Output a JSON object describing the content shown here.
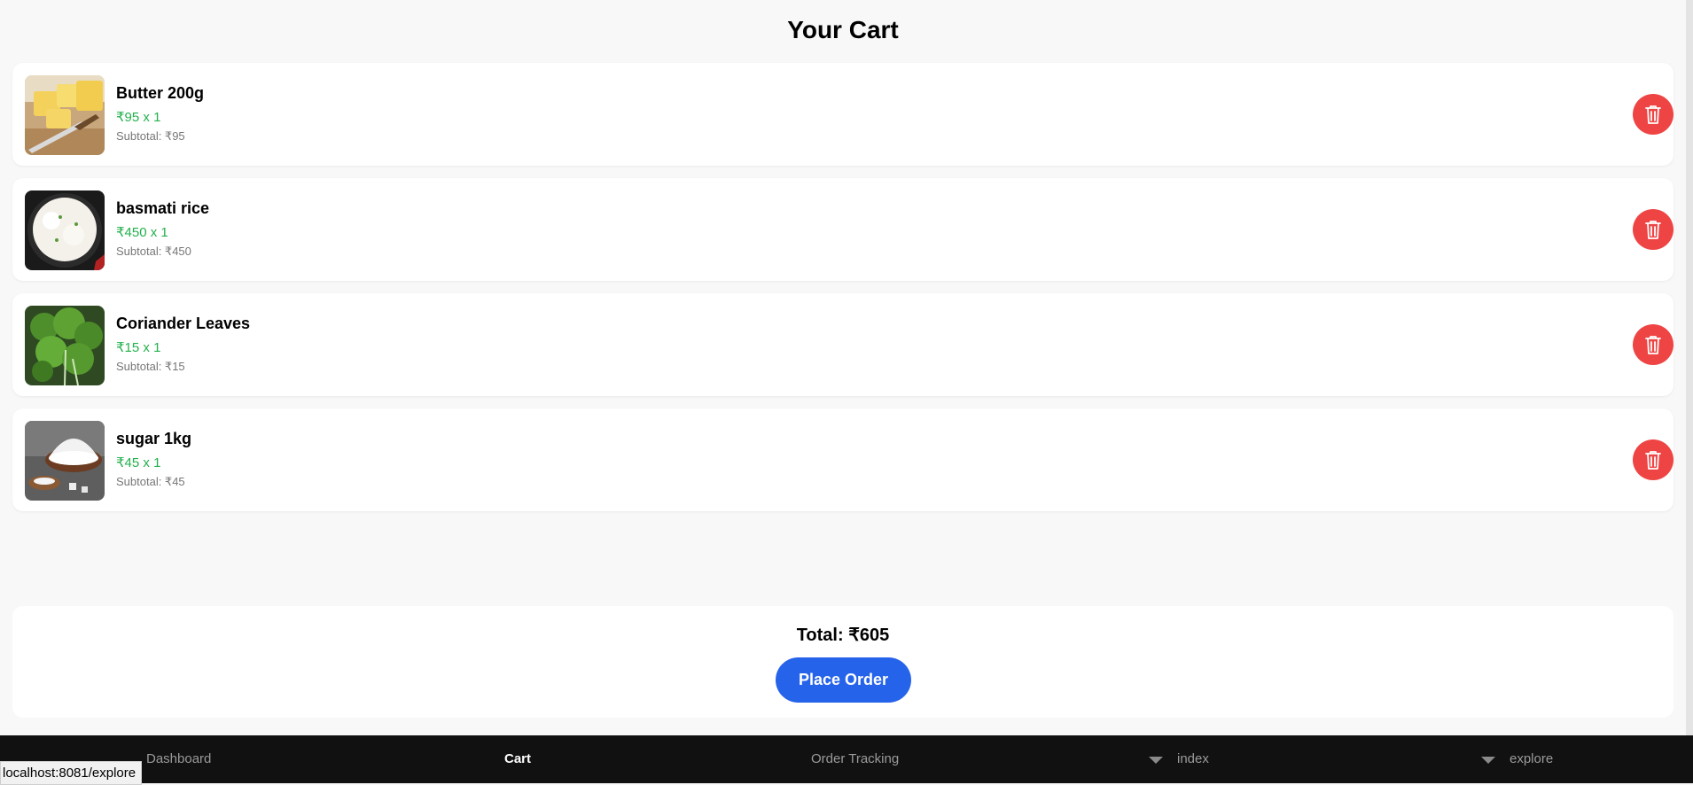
{
  "page": {
    "title": "Your Cart"
  },
  "items": [
    {
      "name": "Butter 200g",
      "price_qty": "₹95 x 1",
      "subtotal": "Subtotal: ₹95",
      "image": "butter-image"
    },
    {
      "name": "basmati rice",
      "price_qty": "₹450 x 1",
      "subtotal": "Subtotal: ₹450",
      "image": "rice-image"
    },
    {
      "name": "Coriander Leaves",
      "price_qty": "₹15 x 1",
      "subtotal": "Subtotal: ₹15",
      "image": "coriander-image"
    },
    {
      "name": "sugar 1kg",
      "price_qty": "₹45 x 1",
      "subtotal": "Subtotal: ₹45",
      "image": "sugar-image"
    }
  ],
  "summary": {
    "total": "Total: ₹605",
    "place_order_label": "Place Order"
  },
  "nav": [
    {
      "label": "Dashboard"
    },
    {
      "label": "Cart",
      "active": true
    },
    {
      "label": "Order Tracking"
    },
    {
      "label": "index"
    },
    {
      "label": "explore"
    }
  ],
  "status_bar": {
    "url": "localhost:8081/explore"
  },
  "colors": {
    "accent": "#2563eb",
    "delete": "#ef4444",
    "price": "#22b14c",
    "nav_bg": "#111111"
  },
  "icons": {
    "delete": "trash-icon",
    "nav_dropdown": "chevron-down-icon"
  }
}
